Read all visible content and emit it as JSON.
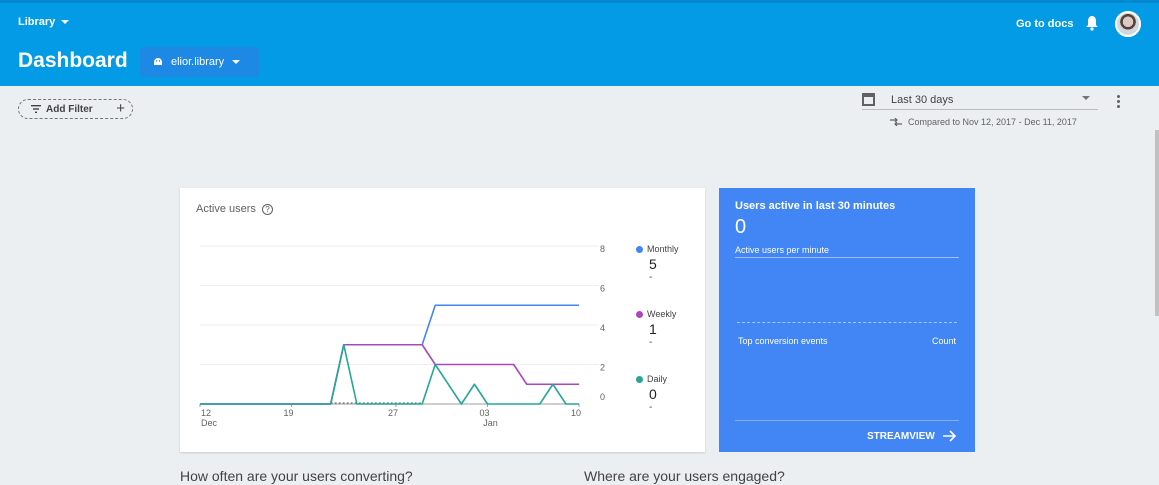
{
  "header": {
    "project": "Library",
    "title": "Dashboard",
    "app": "elior.library",
    "docs_link": "Go to docs"
  },
  "toolbar": {
    "add_filter": "Add Filter",
    "date_range": "Last 30 days",
    "compared_to": "Compared to Nov 12, 2017 - Dec 11, 2017"
  },
  "active_users_card": {
    "title": "Active users",
    "help_glyph": "?",
    "legend": [
      {
        "name": "Monthly",
        "value": "5",
        "delta": "-",
        "color": "#4285f4"
      },
      {
        "name": "Weekly",
        "value": "1",
        "delta": "-",
        "color": "#ab47bc"
      },
      {
        "name": "Daily",
        "value": "0",
        "delta": "-",
        "color": "#26a69a"
      }
    ]
  },
  "chart_data": {
    "type": "line",
    "title": "Active users",
    "x_ticks": [
      {
        "day": 0,
        "label": "12",
        "sub": "Dec"
      },
      {
        "day": 7,
        "label": "19",
        "sub": ""
      },
      {
        "day": 15,
        "label": "27",
        "sub": ""
      },
      {
        "day": 22,
        "label": "03",
        "sub": "Jan"
      },
      {
        "day": 29,
        "label": "10",
        "sub": ""
      }
    ],
    "y_ticks": [
      0,
      2,
      4,
      6,
      8
    ],
    "ylim": [
      0,
      8
    ],
    "xlim": [
      0,
      29
    ],
    "grid": true,
    "legend_position": "right",
    "series": [
      {
        "name": "Monthly",
        "color": "#4285f4",
        "points": [
          [
            0,
            0
          ],
          [
            10,
            0
          ],
          [
            11,
            3
          ],
          [
            17,
            3
          ],
          [
            18,
            5
          ],
          [
            29,
            5
          ]
        ]
      },
      {
        "name": "Weekly",
        "color": "#ab47bc",
        "points": [
          [
            0,
            0
          ],
          [
            10,
            0
          ],
          [
            11,
            3
          ],
          [
            17,
            3
          ],
          [
            18,
            2
          ],
          [
            24,
            2
          ],
          [
            25,
            1
          ],
          [
            29,
            1
          ]
        ]
      },
      {
        "name": "Daily",
        "color": "#26a69a",
        "points": [
          [
            0,
            0
          ],
          [
            10,
            0
          ],
          [
            11,
            3
          ],
          [
            12,
            0
          ],
          [
            17,
            0
          ],
          [
            18,
            2
          ],
          [
            20,
            0
          ],
          [
            21,
            1
          ],
          [
            22,
            0
          ],
          [
            26,
            0
          ],
          [
            27,
            1
          ],
          [
            28,
            0
          ],
          [
            29,
            0
          ]
        ]
      }
    ]
  },
  "realtime_card": {
    "title": "Users active in last 30 minutes",
    "value": "0",
    "subtitle": "Active users per minute",
    "col1": "Top conversion events",
    "col2": "Count",
    "action": "STREAMVIEW"
  },
  "questions": {
    "q1": "How often are your users converting?",
    "q2": "Where are your users engaged?"
  }
}
